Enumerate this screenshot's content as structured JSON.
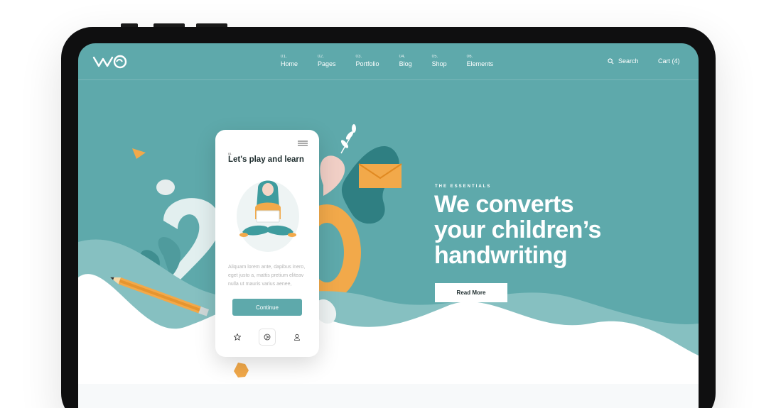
{
  "header": {
    "logo_text": "WO",
    "nav": [
      {
        "num": "01.",
        "label": "Home"
      },
      {
        "num": "02.",
        "label": "Pages"
      },
      {
        "num": "03.",
        "label": "Portfolio"
      },
      {
        "num": "04.",
        "label": "Blog"
      },
      {
        "num": "05.",
        "label": "Shop"
      },
      {
        "num": "06.",
        "label": "Elements"
      }
    ],
    "search_label": "Search",
    "cart_label": "Cart (4)"
  },
  "hero": {
    "eyebrow": "THE ESSENTIALS",
    "headline_line1": "We converts",
    "headline_line2": "your children’s",
    "headline_line3": "handwriting",
    "cta_label": "Read More"
  },
  "phone": {
    "num": "01.",
    "title": "Let's play and learn",
    "body": "Aliquam lorem ante, dapibus inero, eget justo a, mattis pretium eliteav nulla ut mauris varius aenee,",
    "button_label": "Continue",
    "tabs": [
      "star-icon",
      "play-icon",
      "user-icon"
    ]
  },
  "colors": {
    "teal": "#5ea9ab",
    "teal_dark": "#3f8e90",
    "orange": "#f2a94a",
    "white": "#ffffff"
  }
}
